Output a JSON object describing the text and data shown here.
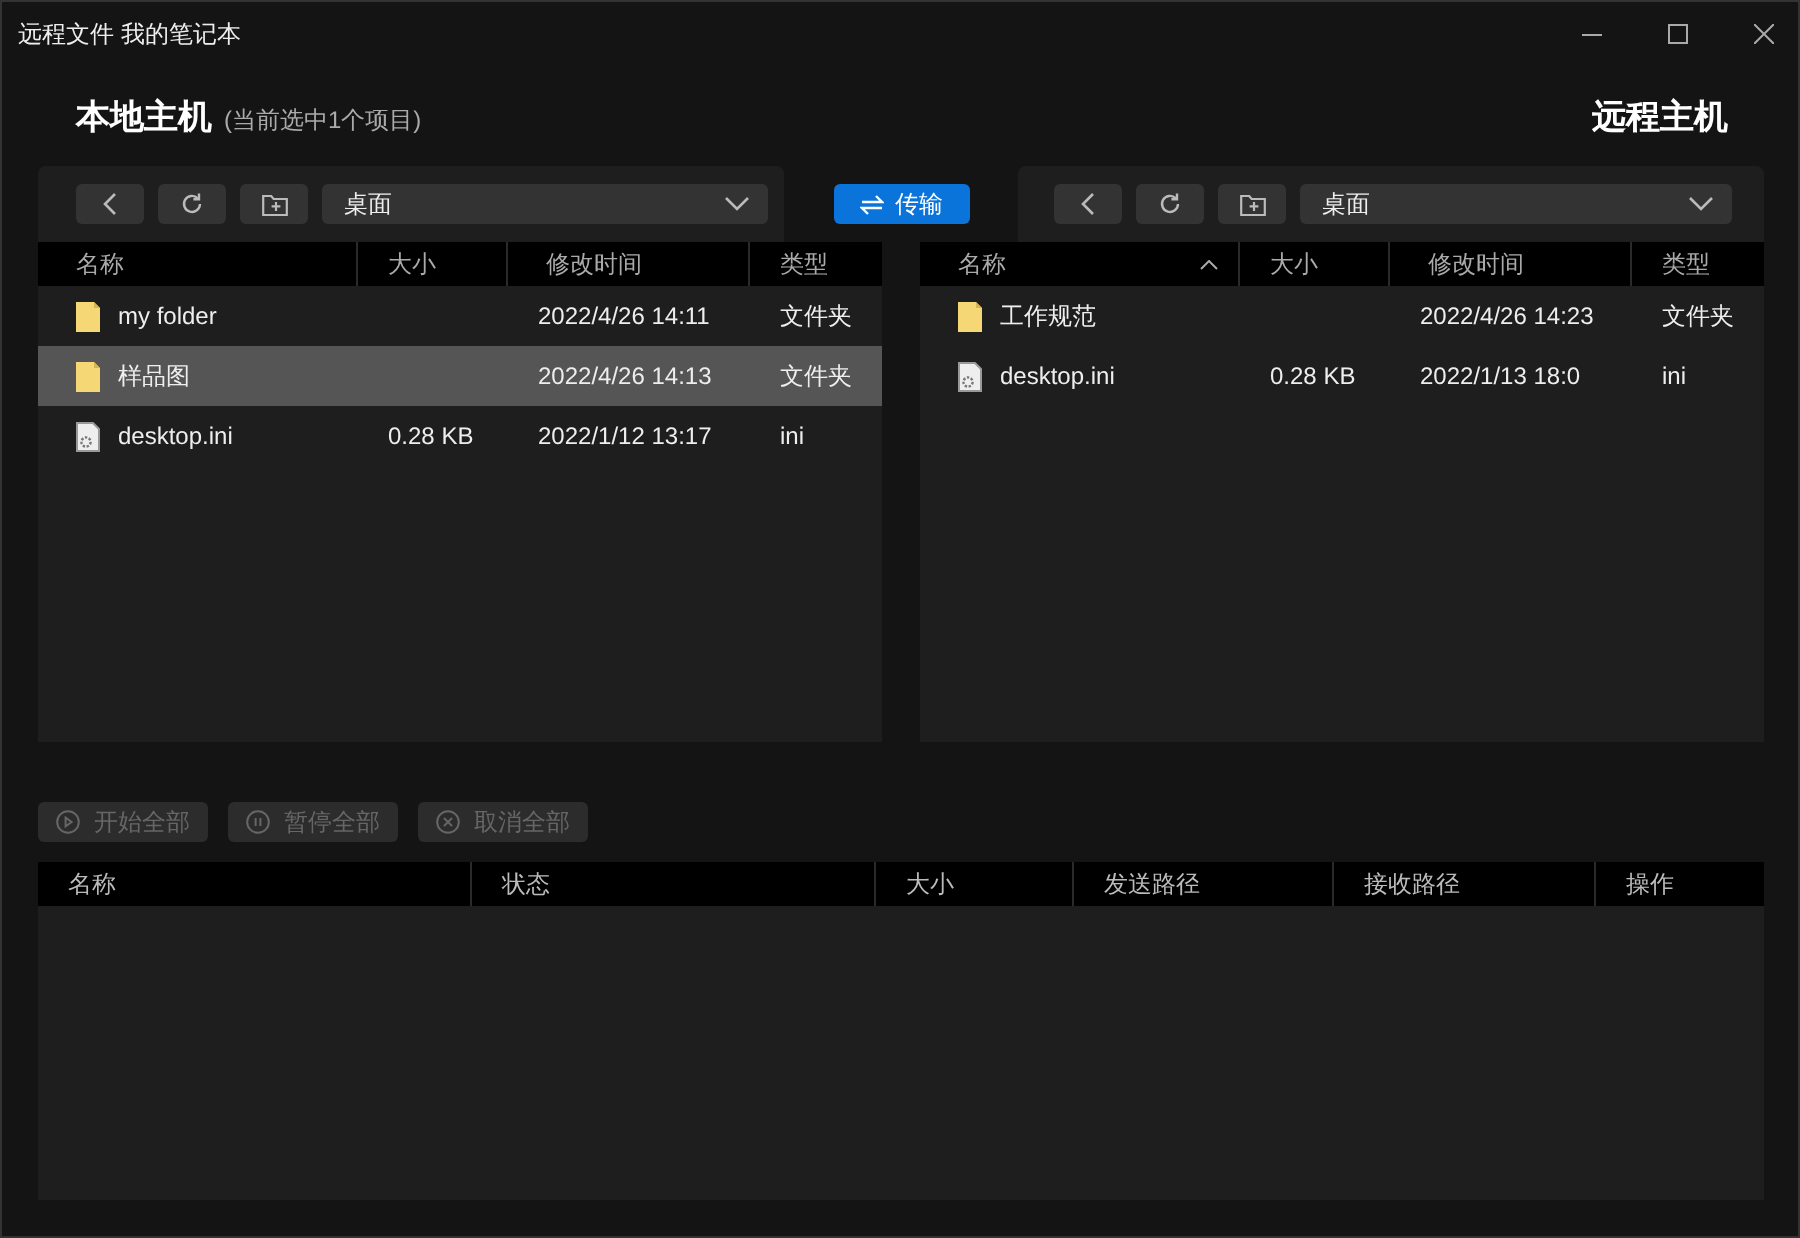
{
  "window": {
    "title": "远程文件 我的笔记本"
  },
  "local": {
    "heading": "本地主机",
    "note": "(当前选中1个项目)",
    "path": "桌面",
    "columns": [
      {
        "label": "名称",
        "sorted": false
      },
      {
        "label": "大小",
        "sorted": false
      },
      {
        "label": "修改时间",
        "sorted": false
      },
      {
        "label": "类型",
        "sorted": false
      }
    ],
    "rows": [
      {
        "kind": "folder",
        "name": "my folder",
        "modified": "2022/4/26 14:11",
        "type": "文件夹",
        "selected": false
      },
      {
        "kind": "folder",
        "name": "样品图",
        "modified": "2022/4/26 14:13",
        "type": "文件夹",
        "selected": true
      },
      {
        "kind": "file",
        "name": "desktop.ini",
        "size": "0.28 KB",
        "modified": "2022/1/12 13:17",
        "type": "ini",
        "selected": false
      }
    ]
  },
  "transfer_button": "传输",
  "remote": {
    "heading": "远程主机",
    "path": "桌面",
    "columns": [
      {
        "label": "名称",
        "sorted": true
      },
      {
        "label": "大小",
        "sorted": false
      },
      {
        "label": "修改时间",
        "sorted": false
      },
      {
        "label": "类型",
        "sorted": false
      }
    ],
    "rows": [
      {
        "kind": "folder",
        "name": "工作规范",
        "modified": "2022/4/26 14:23",
        "type": "文件夹",
        "selected": false
      },
      {
        "kind": "file",
        "name": "desktop.ini",
        "size": "0.28 KB",
        "modified": "2022/1/13 18:0",
        "type": "ini",
        "selected": false
      }
    ]
  },
  "transfers": {
    "buttons": [
      {
        "kind": "start",
        "label": "开始全部",
        "disabled": true
      },
      {
        "kind": "pause",
        "label": "暂停全部",
        "disabled": true
      },
      {
        "kind": "cancel",
        "label": "取消全部",
        "disabled": true
      }
    ],
    "columns": [
      "名称",
      "状态",
      "大小",
      "发送路径",
      "接收路径",
      "操作"
    ]
  }
}
